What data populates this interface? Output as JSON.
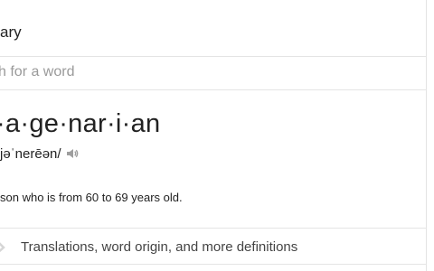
{
  "header": {
    "title": "ary"
  },
  "search": {
    "placeholder": "h for a word",
    "value": ""
  },
  "entry": {
    "headword": "·a·ge·nar·i·an",
    "phonetic": "jəˈnerēən/",
    "definition": "son who is from 60 to 69 years old."
  },
  "more": {
    "label": "Translations, word origin, and more definitions"
  },
  "icons": {
    "speaker": "speaker-icon",
    "expand": "chevron-down-icon"
  },
  "colors": {
    "text": "#222222",
    "placeholder": "#9a9a9a",
    "divider": "#e4e4e4",
    "icon": "#9e9e9e"
  }
}
